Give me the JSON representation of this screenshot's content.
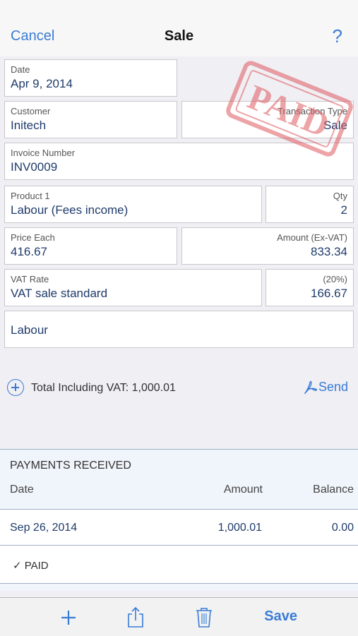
{
  "nav": {
    "cancel": "Cancel",
    "title": "Sale",
    "help": "?"
  },
  "stamp": {
    "text": "PAID",
    "color": "#e05a60"
  },
  "fields": {
    "date": {
      "label": "Date",
      "value": "Apr 9, 2014"
    },
    "customer": {
      "label": "Customer",
      "value": "Initech"
    },
    "transaction_type": {
      "label": "Transaction Type",
      "value": "Sale"
    },
    "invoice_number": {
      "label": "Invoice Number",
      "value": "INV0009"
    },
    "product": {
      "label": "Product 1",
      "value": "Labour (Fees income)"
    },
    "qty": {
      "label": "Qty",
      "value": "2"
    },
    "price_each": {
      "label": "Price Each",
      "value": "416.67"
    },
    "amount_ex_vat": {
      "label": "Amount (Ex-VAT)",
      "value": "833.34"
    },
    "vat_rate": {
      "label": "VAT Rate",
      "value": "VAT sale standard"
    },
    "vat_amount": {
      "label": "(20%)",
      "value": "166.67"
    },
    "description": {
      "value": "Labour"
    }
  },
  "total": {
    "text": "Total Including VAT: 1,000.01"
  },
  "send": {
    "label": "Send",
    "icon": "pdf-icon"
  },
  "payments": {
    "header": "PAYMENTS RECEIVED",
    "columns": [
      "Date",
      "Amount",
      "Balance"
    ],
    "rows": [
      {
        "date": "Sep 26, 2014",
        "amount": "1,000.01",
        "balance": "0.00"
      }
    ],
    "status": "✓  PAID"
  },
  "toolbar": {
    "add_icon": "plus-icon",
    "share_icon": "share-icon",
    "trash_icon": "trash-icon",
    "save": "Save"
  },
  "colors": {
    "accent": "#3a7bd5",
    "value_text": "#1f3b6b"
  }
}
